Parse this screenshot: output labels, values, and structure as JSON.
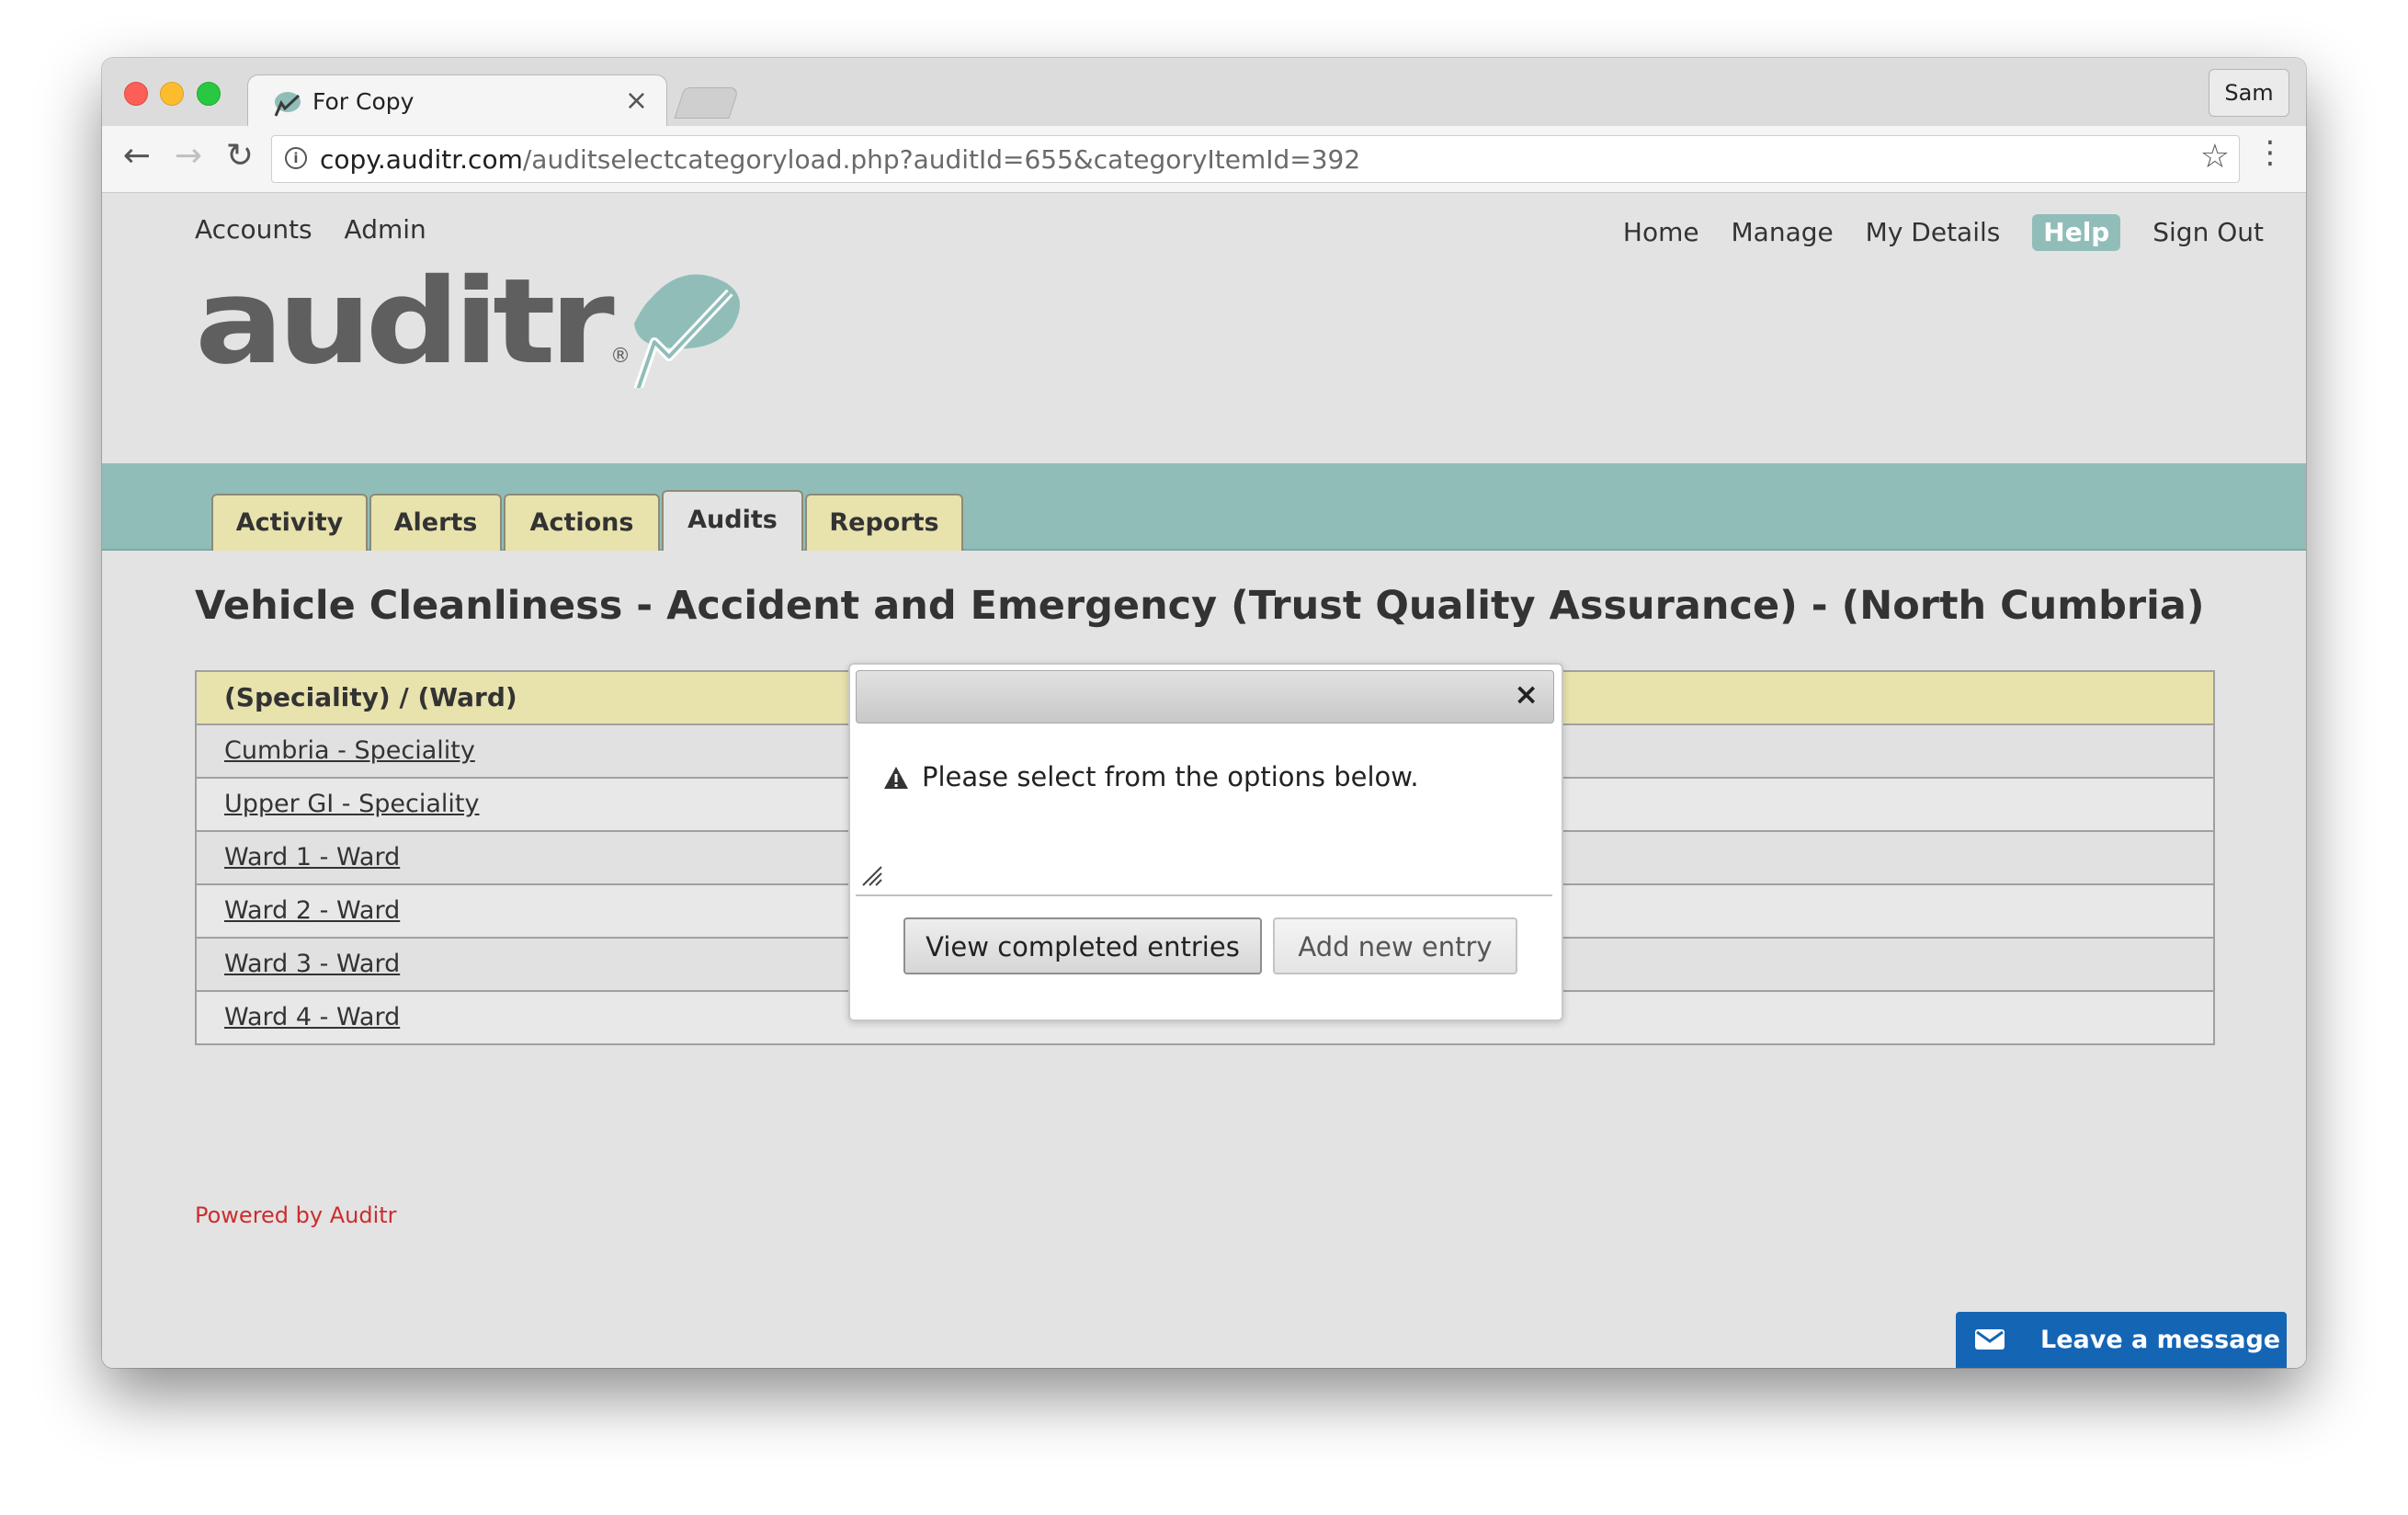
{
  "browser": {
    "tab_title": "For Copy",
    "tab_close": "×",
    "profile": "Sam",
    "url_host": "copy.auditr.com",
    "url_path": "/auditselectcategoryload.php?auditId=655&categoryItemId=392",
    "icons": {
      "back": "←",
      "forward": "→",
      "reload": "↻",
      "info": "i",
      "star": "☆",
      "menu": "⋮"
    }
  },
  "topnav": {
    "left": [
      "Accounts",
      "Admin"
    ],
    "right": [
      "Home",
      "Manage",
      "My Details",
      "Help",
      "Sign Out"
    ]
  },
  "logo": {
    "text": "auditr",
    "registered": "®",
    "accent_color": "#91bdb9",
    "text_color": "#5f5f5f"
  },
  "tabs": [
    {
      "label": "Activity",
      "active": false
    },
    {
      "label": "Alerts",
      "active": false
    },
    {
      "label": "Actions",
      "active": false
    },
    {
      "label": "Audits",
      "active": true
    },
    {
      "label": "Reports",
      "active": false
    }
  ],
  "page_title": "Vehicle Cleanliness - Accident and Emergency (Trust Quality Assurance) - (North Cumbria)",
  "table": {
    "header": "(Speciality) / (Ward)",
    "rows": [
      "Cumbria - Speciality",
      "Upper GI - Speciality",
      "Ward 1 - Ward",
      "Ward 2 - Ward",
      "Ward 3 - Ward",
      "Ward 4 - Ward"
    ]
  },
  "footer": {
    "powered": "Powered by Auditr"
  },
  "chat_widget": {
    "label": "Leave a message"
  },
  "modal": {
    "close": "×",
    "message": "Please select from the options below.",
    "buttons": {
      "view": "View completed entries",
      "add": "Add new entry"
    }
  },
  "colors": {
    "teal": "#91bdb9",
    "tab_bg": "#e8e2ad",
    "powered_red": "#cc2d2d",
    "chat_blue": "#1565b5"
  }
}
